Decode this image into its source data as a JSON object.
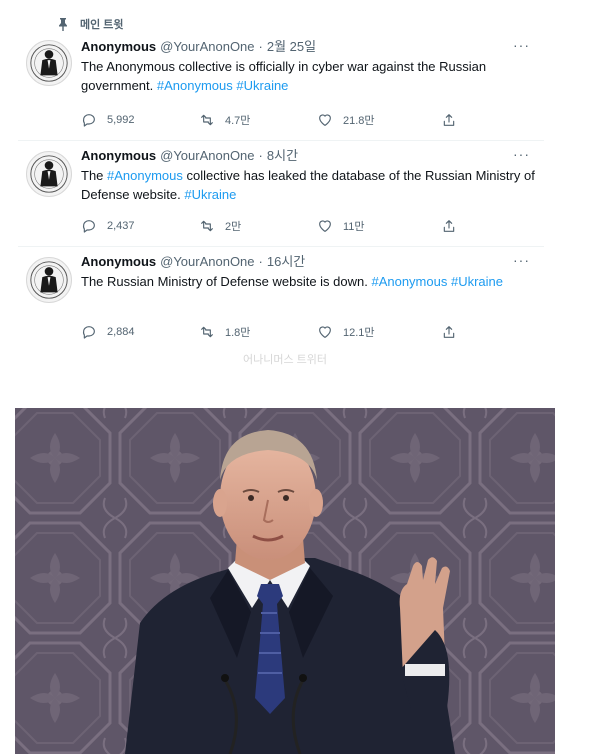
{
  "pinned_label": "메인 트윗",
  "tweets": [
    {
      "name": "Anonymous",
      "handle": "@YourAnonOne",
      "separator": "·",
      "time": "2월 25일",
      "text_1": "The Anonymous collective is officially in cyber war against the Russian government. ",
      "tag_1": "#Anonymous",
      "text_2": " ",
      "tag_2": "#Ukraine",
      "text_3": "",
      "more": "···",
      "replies": "5,992",
      "retweets": "4.7만",
      "likes": "21.8만"
    },
    {
      "name": "Anonymous",
      "handle": "@YourAnonOne",
      "separator": "·",
      "time": "8시간",
      "text_1": "The ",
      "tag_1": "#Anonymous",
      "text_2": " collective has leaked the database of the Russian Ministry of Defense website. ",
      "tag_2": "#Ukraine",
      "text_3": "",
      "more": "···",
      "replies": "2,437",
      "retweets": "2만",
      "likes": "11만"
    },
    {
      "name": "Anonymous",
      "handle": "@YourAnonOne",
      "separator": "·",
      "time": "16시간",
      "text_1": "The Russian Ministry of Defense website is down. ",
      "tag_1": "#Anonymous",
      "text_2": " ",
      "tag_2": "#Ukraine",
      "text_3": "",
      "more": "···",
      "replies": "2,884",
      "retweets": "1.8만",
      "likes": "12.1만"
    }
  ],
  "watermark": "어나니머스 트위터",
  "colors": {
    "link": "#1d9bf0",
    "muted": "#536471",
    "photo_background": "#5e5567",
    "suit": "#1d2130",
    "tie": "#2b3a78"
  },
  "icons": [
    "pin-icon",
    "reply-icon",
    "retweet-icon",
    "like-icon",
    "share-icon",
    "more-icon"
  ]
}
